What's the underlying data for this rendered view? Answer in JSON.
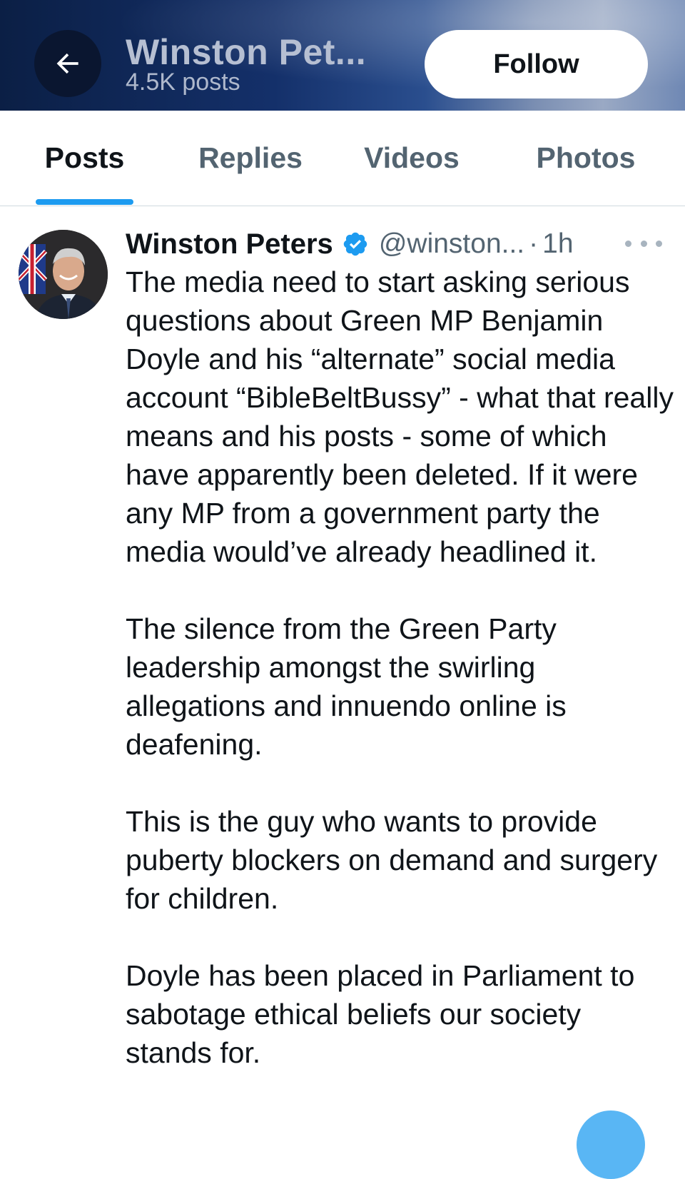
{
  "header": {
    "display_name": "Winston Pet...",
    "post_count": "4.5K posts",
    "follow_label": "Follow",
    "back_icon": "arrow-left-icon"
  },
  "tabs": [
    {
      "label": "Posts",
      "active": true
    },
    {
      "label": "Replies",
      "active": false
    },
    {
      "label": "Videos",
      "active": false
    },
    {
      "label": "Photos",
      "active": false
    }
  ],
  "post": {
    "author_name": "Winston Peters",
    "verified": true,
    "handle": "@winston...",
    "separator": "·",
    "time": "1h",
    "paragraphs": [
      "The media need to start asking serious questions about Green MP Benjamin Doyle and his “alternate” social media account “BibleBeltBussy” - what that really means and his posts - some of which have apparently been deleted. If it were any MP from a government party the media would’ve already headlined it.",
      "The silence from the Green Party leadership amongst the swirling allegations and innuendo online is deafening.",
      "This is the guy who wants to provide puberty blockers on demand and surgery for children.",
      "Doyle has been placed in Parliament to sabotage ethical beliefs our society stands for."
    ]
  },
  "colors": {
    "accent": "#1d9bf0",
    "text_primary": "#0f1419",
    "text_secondary": "#536471"
  }
}
